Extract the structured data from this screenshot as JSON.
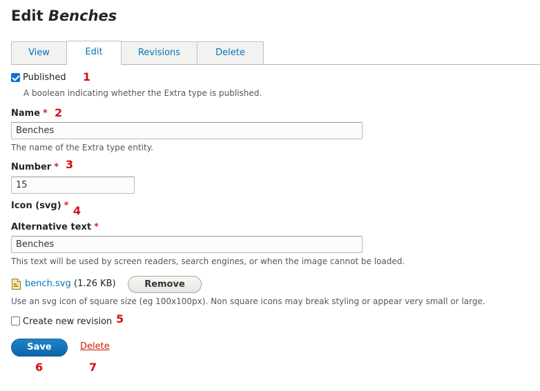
{
  "page_title": {
    "prefix": "Edit",
    "entity": "Benches"
  },
  "tabs": [
    {
      "label": "View",
      "active": false
    },
    {
      "label": "Edit",
      "active": true
    },
    {
      "label": "Revisions",
      "active": false
    },
    {
      "label": "Delete",
      "active": false
    }
  ],
  "published": {
    "label": "Published",
    "checked": true,
    "description": "A boolean indicating whether the Extra type is published."
  },
  "name": {
    "label": "Name",
    "required_mark": "*",
    "value": "Benches",
    "description": "The name of the Extra type entity."
  },
  "number": {
    "label": "Number",
    "required_mark": "*",
    "value": "15"
  },
  "icon": {
    "label": "Icon (svg)",
    "required_mark": "*",
    "alt_label": "Alternative text",
    "alt_required_mark": "*",
    "alt_value": "Benches",
    "alt_description": "This text will be used by screen readers, search engines, or when the image cannot be loaded.",
    "file_name": "bench.svg",
    "file_size": "(1.26 KB)",
    "remove_label": "Remove",
    "description": "Use an svg icon of square size (eg 100x100px). Non square icons may break styling or appear very small or large."
  },
  "revision": {
    "label": "Create new revision",
    "checked": false
  },
  "actions": {
    "save_label": "Save",
    "delete_label": "Delete"
  },
  "annotation_markers": [
    "1",
    "2",
    "3",
    "4",
    "5",
    "6",
    "7"
  ],
  "colors": {
    "link": "#0074bd",
    "primary_button": "#0c65a8",
    "delete_link": "#c72100",
    "required": "#dc2323",
    "annotation": "#d40f0f"
  }
}
